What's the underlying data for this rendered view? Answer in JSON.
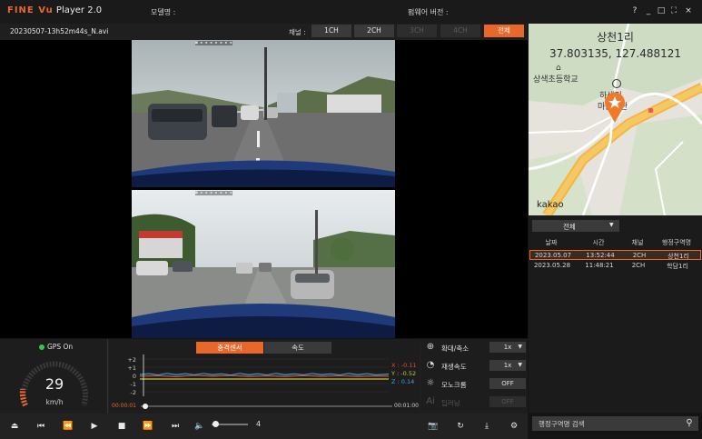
{
  "app": {
    "title_brand": "FINE Vu",
    "title_suffix": " Player 2.0",
    "model_label": "모델명 :",
    "firmware_label": "펌웨어 버전 :",
    "window_buttons": [
      "?",
      "_",
      "□",
      "⛶",
      "×"
    ]
  },
  "video_header": {
    "filename": "20230507-13h52m44s_N.avi",
    "channel_label": "채널 :",
    "channels": [
      {
        "label": "1CH",
        "state": "normal"
      },
      {
        "label": "2CH",
        "state": "normal"
      },
      {
        "label": "3CH",
        "state": "disabled"
      },
      {
        "label": "4CH",
        "state": "disabled"
      },
      {
        "label": "전체",
        "state": "active"
      }
    ]
  },
  "map": {
    "place": "상천1리",
    "coords": "37.803135, 127.488121",
    "labels": [
      "상색초등학교",
      "하색리",
      "마을회관"
    ],
    "provider": "kakao"
  },
  "list": {
    "filter": "전체",
    "columns": [
      "날짜",
      "시간",
      "채널",
      "행정구역명"
    ],
    "rows": [
      {
        "date": "2023.05.07",
        "time": "13:52:44",
        "ch": "2CH",
        "region": "상천1리",
        "selected": true
      },
      {
        "date": "2023.05.28",
        "time": "11:48:21",
        "ch": "2CH",
        "region": "학담1리",
        "selected": false
      }
    ]
  },
  "gps": {
    "status": "GPS On",
    "speed": "29",
    "unit": "km/h"
  },
  "graph": {
    "tabs": [
      "충격센서",
      "속도"
    ],
    "yticks": [
      "+2",
      "+1",
      "0",
      "-1",
      "-2"
    ],
    "x_label": "X : -0.11",
    "y_label": "Y : -0.52",
    "z_label": "Z : 0.14",
    "time_start": "00:00:01",
    "time_end": "00:01:00"
  },
  "options": [
    {
      "icon": "zoom-icon",
      "label": "확대/축소",
      "control": "1x",
      "dropdown": true,
      "dim": false
    },
    {
      "icon": "playback-speed-icon",
      "label": "재생속도",
      "control": "1x",
      "dropdown": true,
      "dim": false
    },
    {
      "icon": "brightness-icon",
      "label": "모노크롬",
      "control": "OFF",
      "dropdown": false,
      "dim": false
    },
    {
      "icon": "ai-icon",
      "label": "딥러닝",
      "control": "OFF",
      "dropdown": false,
      "dim": true
    }
  ],
  "controls": {
    "volume": "4",
    "volume_fraction": 0.1
  },
  "search": {
    "placeholder": "행정구역명 검색"
  },
  "colors": {
    "accent": "#e8682c",
    "gps_on": "#3ac44a",
    "graph_x": "#e84a3a",
    "graph_y": "#c8c832",
    "graph_z": "#3aa8e8"
  }
}
